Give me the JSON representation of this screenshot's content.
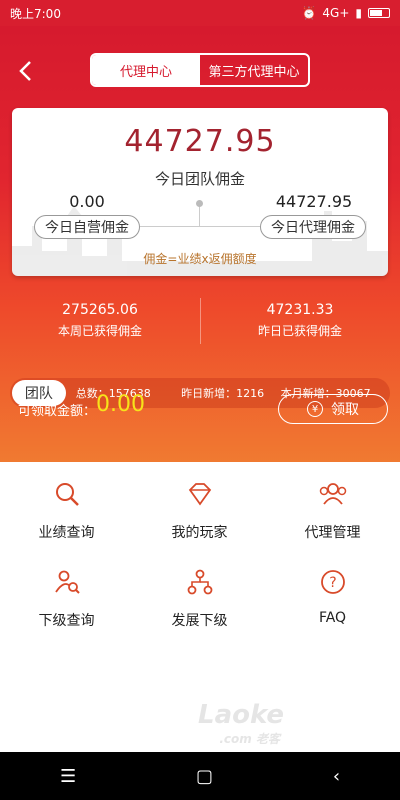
{
  "status_bar": {
    "time": "晚上7:00",
    "network": "4G+"
  },
  "header": {
    "tabs": [
      {
        "label": "代理中心",
        "active": true
      },
      {
        "label": "第三方代理中心",
        "active": false
      }
    ]
  },
  "card": {
    "team_total": "44727.95",
    "team_total_label": "今日团队佣金",
    "self_value": "0.00",
    "self_label": "今日自营佣金",
    "agent_value": "44727.95",
    "agent_label": "今日代理佣金",
    "formula": "佣金=业绩x返佣额度"
  },
  "stats": {
    "week": {
      "value": "275265.06",
      "label": "本周已获得佣金"
    },
    "yesterday": {
      "value": "47231.33",
      "label": "昨日已获得佣金"
    }
  },
  "team_bar": {
    "badge": "团队",
    "total": "总数：157638",
    "yesterday_new": "昨日新增：1216",
    "month_new": "本月新增：30067"
  },
  "claim": {
    "label": "可领取金额：",
    "amount": "0.00",
    "button": "领取"
  },
  "menu": [
    {
      "label": "业绩查询",
      "icon": "search-icon"
    },
    {
      "label": "我的玩家",
      "icon": "diamond-icon"
    },
    {
      "label": "代理管理",
      "icon": "group-icon"
    },
    {
      "label": "下级查询",
      "icon": "user-search-icon"
    },
    {
      "label": "发展下级",
      "icon": "hierarchy-icon"
    },
    {
      "label": "FAQ",
      "icon": "question-icon"
    }
  ],
  "colors": {
    "primary": "#d61a2e",
    "gradient_end": "#f07a31",
    "amount_highlight": "#f7e31a",
    "accent_text": "#a3232f"
  }
}
